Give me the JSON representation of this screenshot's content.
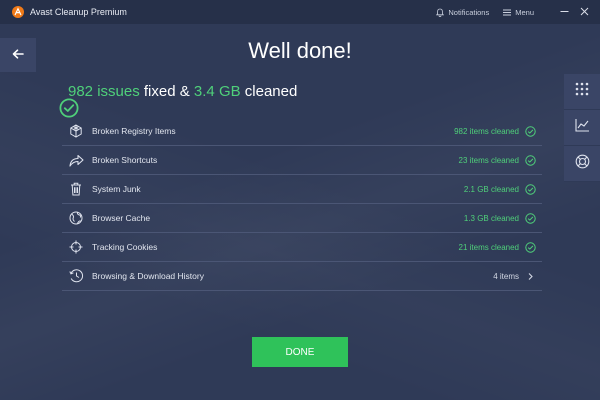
{
  "app": {
    "title": "Avast Cleanup Premium"
  },
  "titlebar": {
    "notifications_label": "Notifications",
    "menu_label": "Menu"
  },
  "heading": "Well done!",
  "summary": {
    "issues_count": "982 issues",
    "fixed_text": " fixed & ",
    "cleaned_size": "3.4 GB",
    "cleaned_text": " cleaned"
  },
  "items": [
    {
      "label": "Broken Registry Items",
      "status": "982 items cleaned",
      "icon": "registry-icon",
      "state": "cleaned"
    },
    {
      "label": "Broken Shortcuts",
      "status": "23 items cleaned",
      "icon": "shortcut-arrow-icon",
      "state": "cleaned"
    },
    {
      "label": "System Junk",
      "status": "2.1 GB cleaned",
      "icon": "trash-icon",
      "state": "cleaned"
    },
    {
      "label": "Browser Cache",
      "status": "1.3 GB cleaned",
      "icon": "globe-icon",
      "state": "cleaned"
    },
    {
      "label": "Tracking Cookies",
      "status": "21 items cleaned",
      "icon": "crosshair-icon",
      "state": "cleaned"
    },
    {
      "label": "Browsing & Download History",
      "status": "4 items",
      "icon": "history-icon",
      "state": "expandable"
    }
  ],
  "done_button": "DONE",
  "colors": {
    "background": "#2f3a57",
    "titlebar": "#263049",
    "accent_green": "#4fd07a",
    "button_green": "#2fc25a",
    "avast_orange": "#f07a18"
  }
}
